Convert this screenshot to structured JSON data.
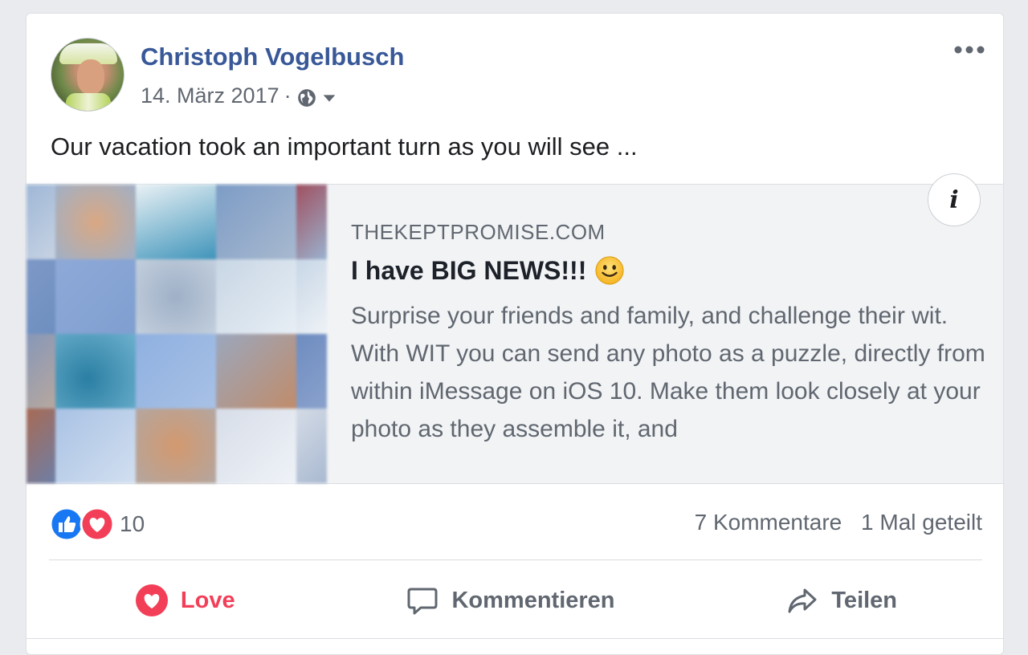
{
  "post": {
    "author_name": "Christoph Vogelbusch",
    "date": "14. März 2017",
    "separator": "·",
    "audience_icon": "globe-icon",
    "text": "Our vacation took an important turn as you will see ..."
  },
  "link_preview": {
    "domain": "THEKEPTPROMISE.COM",
    "title": "I have BIG NEWS!!!",
    "title_emoji": "smiley-emoji",
    "description": "Surprise your friends and family, and challenge their wit. With WIT you can send any photo as a puzzle, directly from within iMessage on iOS 10. Make them look closely at your photo as they assemble it, and",
    "info_label": "i"
  },
  "stats": {
    "reaction_count": "10",
    "reaction_icons": [
      "like-icon",
      "love-icon"
    ],
    "comments": "7 Kommentare",
    "shares": "1 Mal geteilt"
  },
  "actions": {
    "love_label": "Love",
    "comment_label": "Kommentieren",
    "share_label": "Teilen"
  },
  "colors": {
    "author_link": "#385898",
    "love_red": "#f33e58",
    "like_blue": "#1877f2",
    "secondary_text": "#606770"
  }
}
